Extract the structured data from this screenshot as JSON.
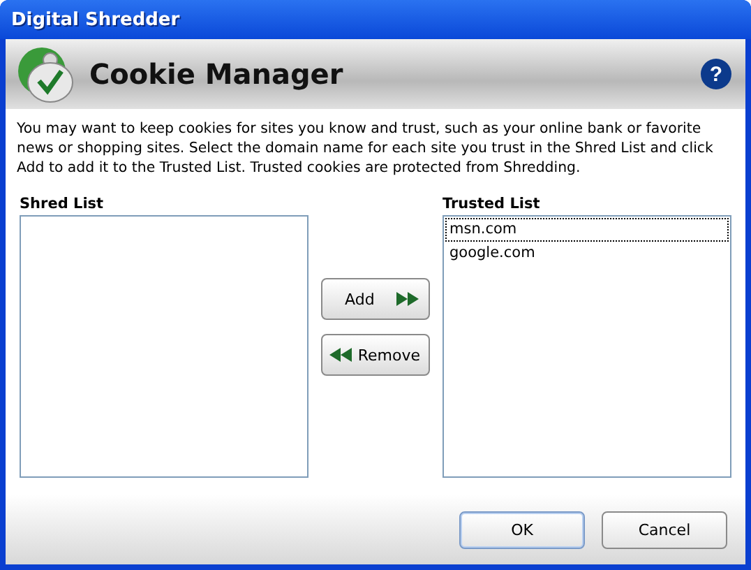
{
  "window": {
    "title": "Digital Shredder"
  },
  "header": {
    "title": "Cookie Manager",
    "help": "?"
  },
  "description": "You may want to keep cookies for sites you know and trust, such as your online bank or favorite news or shopping sites. Select the domain name for each site you trust in the Shred List and click Add to add it to the Trusted List. Trusted cookies are protected from Shredding.",
  "shred_list": {
    "label": "Shred List"
  },
  "trusted_list": {
    "label": "Trusted List",
    "items": [
      {
        "text": "msn.com",
        "focused": true
      },
      {
        "text": "google.com",
        "focused": false
      }
    ]
  },
  "transfer_buttons": [
    {
      "label": "Add",
      "kind": "add"
    },
    {
      "label": "Remove",
      "kind": "remove"
    }
  ],
  "buttons": [
    {
      "label": "OK",
      "default": true
    },
    {
      "label": "Cancel",
      "default": false
    }
  ]
}
